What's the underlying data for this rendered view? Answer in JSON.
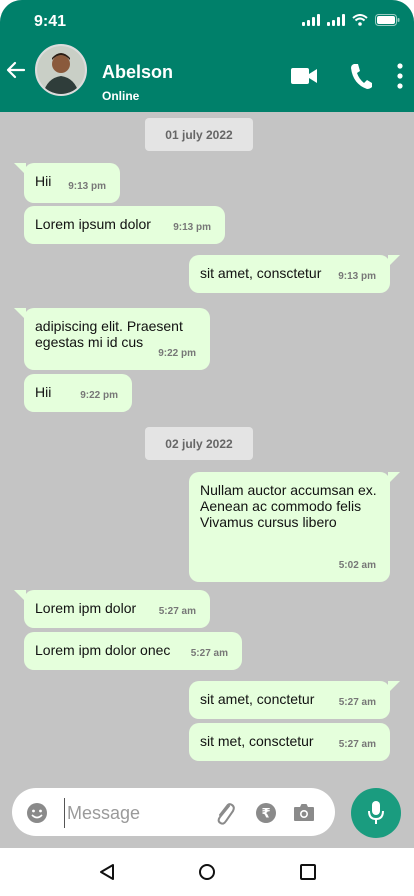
{
  "status_bar": {
    "time": "9:41"
  },
  "header": {
    "contact_name": "Abelson",
    "contact_status": "Online",
    "icons": [
      "back-arrow-icon",
      "video-call-icon",
      "phone-icon",
      "more-vert-icon"
    ]
  },
  "colors": {
    "header_bg": "#00806a",
    "chat_bg": "#c4c4c4",
    "bubble_bg": "#e5ffdc",
    "mic_bg": "#1a9c7f"
  },
  "dates": [
    "01 july 2022",
    "02 july 2022"
  ],
  "messages": [
    {
      "text": "Hii",
      "time": "9:13 pm",
      "direction": "incoming"
    },
    {
      "text": "Lorem ipsum dolor",
      "time": "9:13 pm",
      "direction": "incoming"
    },
    {
      "text": "sit amet, consctetur",
      "time": "9:13 pm",
      "direction": "outgoing"
    },
    {
      "text": "adipiscing elit. Praesent\negestas mi id cus",
      "time": "9:22 pm",
      "direction": "incoming"
    },
    {
      "text": "Hii",
      "time": "9:22 pm",
      "direction": "incoming"
    },
    {
      "text": "Nullam auctor accumsan ex.\nAenean ac commodo felis\nVivamus cursus libero",
      "time": "5:02 am",
      "direction": "outgoing"
    },
    {
      "text": "Lorem ipm dolor",
      "time": "5:27 am",
      "direction": "incoming"
    },
    {
      "text": "Lorem ipm dolor onec",
      "time": "5:27 am",
      "direction": "incoming"
    },
    {
      "text": "sit amet, conctetur",
      "time": "5:27 am",
      "direction": "outgoing"
    },
    {
      "text": "sit met, consctetur",
      "time": "5:27 am",
      "direction": "outgoing"
    }
  ],
  "composer": {
    "placeholder": "Message",
    "icons": [
      "emoji-icon",
      "attach-icon",
      "rupee-payment-icon",
      "camera-icon",
      "mic-icon"
    ]
  },
  "nav": {
    "icons": [
      "back-triangle-icon",
      "home-circle-icon",
      "recents-square-icon"
    ]
  }
}
